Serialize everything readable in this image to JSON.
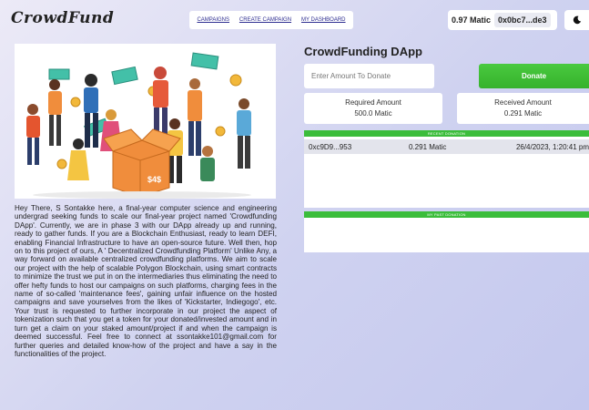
{
  "header": {
    "logo": "CrowdFund",
    "nav": [
      "CAMPAIGNS",
      "CREATE CAMPAIGN",
      "MY DASHBOARD"
    ],
    "wallet": {
      "balance": "0.97 Matic",
      "address": "0x0bc7...de3"
    },
    "theme_icon": "moon-icon"
  },
  "description": "Hey There, S Sontakke here, a final-year computer science and engineering undergrad seeking funds to scale our final-year project named 'Crowdfunding DApp'. Currently, we are in phase 3 with our DApp already up and running, ready to gather funds. If you are a Blockchain Enthusiast, ready to learn DEFI, enabling Financial Infrastructure to have an open-source future. Well then, hop on to this project of ours, A ' Decentralized Crowdfunding Platform' Unlike Any, a way forward on available centralized crowdfunding platforms. We aim to scale our project with the help of scalable Polygon Blockchain, using smart contracts to minimize the trust we put in on the intermediaries thus eliminating the need to offer hefty funds to host our campaigns on such platforms, charging fees in the name of so-called 'maintenance fees', gaining unfair influence on the hosted campaigns and save yourselves from the likes of 'Kickstarter, Indiegogo', etc. Your trust is requested to further incorporate in our project the aspect of tokenization such that you get a token for your donated/invested amount and in turn get a claim on your staked amount/project if and when the campaign is deemed successful. Feel free to connect at ssontakke101@gmail.com for further queries and detailed know-how of the project and have a say in the functionalities of the project.",
  "hero": {
    "box_label": "$4$"
  },
  "dapp": {
    "title": "CrowdFunding DApp",
    "input_placeholder": "Enter Amount To Donate",
    "donate_label": "Donate",
    "required": {
      "label": "Required Amount",
      "value": "500.0 Matic"
    },
    "received": {
      "label": "Received Amount",
      "value": "0.291 Matic"
    },
    "recent_header": "RECENT DONATION",
    "donations": [
      {
        "address": "0xc9D9...953",
        "amount": "0.291 Matic",
        "time": "26/4/2023, 1:20:41 pm"
      }
    ],
    "past_header": "MY PAST DONATION"
  },
  "colors": {
    "accent_green": "#3bbd3b",
    "nav_link": "#2b2b8f",
    "background": "#cfd2f0"
  }
}
